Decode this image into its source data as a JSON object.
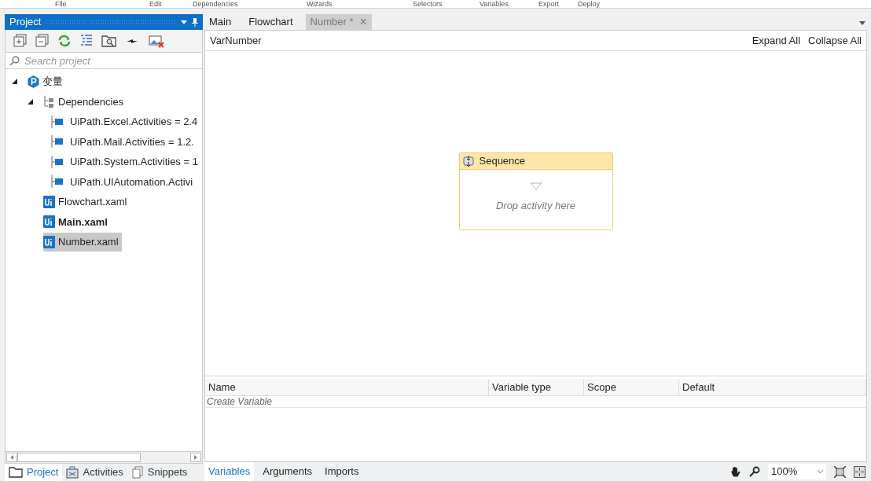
{
  "ribbon_groups": [
    "File",
    "Edit",
    "Dependencies",
    "Wizards",
    "Selectors",
    "Variables",
    "Export",
    "Deploy"
  ],
  "project_panel": {
    "title": "Project",
    "search": {
      "placeholder": "Search project"
    },
    "tree": [
      {
        "kind": "project",
        "label": "变量",
        "expanded": true,
        "selected": false,
        "children": [
          {
            "kind": "dependencies",
            "label": "Dependencies",
            "expanded": true,
            "selected": false,
            "children": [
              {
                "kind": "package",
                "label": "UiPath.Excel.Activities = 2.4",
                "selected": false
              },
              {
                "kind": "package",
                "label": "UiPath.Mail.Activities = 1.2.",
                "selected": false
              },
              {
                "kind": "package",
                "label": "UiPath.System.Activities = 1",
                "selected": false
              },
              {
                "kind": "package",
                "label": "UiPath.UIAutomation.Activi",
                "selected": false
              }
            ]
          },
          {
            "kind": "file",
            "label": "Flowchart.xaml",
            "main": false,
            "selected": false
          },
          {
            "kind": "file",
            "label": "Main.xaml",
            "main": true,
            "selected": false
          },
          {
            "kind": "file",
            "label": "Number.xaml",
            "main": false,
            "selected": true
          }
        ]
      }
    ],
    "bottom_tabs": [
      {
        "label": "Project",
        "kind": "project",
        "selected": true
      },
      {
        "label": "Activities",
        "kind": "activities",
        "selected": false
      },
      {
        "label": "Snippets",
        "kind": "snippets",
        "selected": false
      }
    ]
  },
  "document_tabs": [
    {
      "label": "Main",
      "selected": false
    },
    {
      "label": "Flowchart",
      "selected": false
    },
    {
      "label": "Number *",
      "selected": true,
      "close": "×"
    }
  ],
  "designer": {
    "breadcrumb": "VarNumber",
    "expand_all": "Expand All",
    "collapse_all": "Collapse All",
    "sequence": {
      "title": "Sequence",
      "hint": "Drop activity here"
    }
  },
  "variables_grid": {
    "columns": [
      "Name",
      "Variable type",
      "Scope",
      "Default"
    ],
    "create_row": "Create Variable"
  },
  "bottom_tabs": [
    {
      "label": "Variables",
      "selected": true
    },
    {
      "label": "Arguments",
      "selected": false
    },
    {
      "label": "Imports",
      "selected": false
    }
  ],
  "zoom": {
    "value": "100%"
  }
}
